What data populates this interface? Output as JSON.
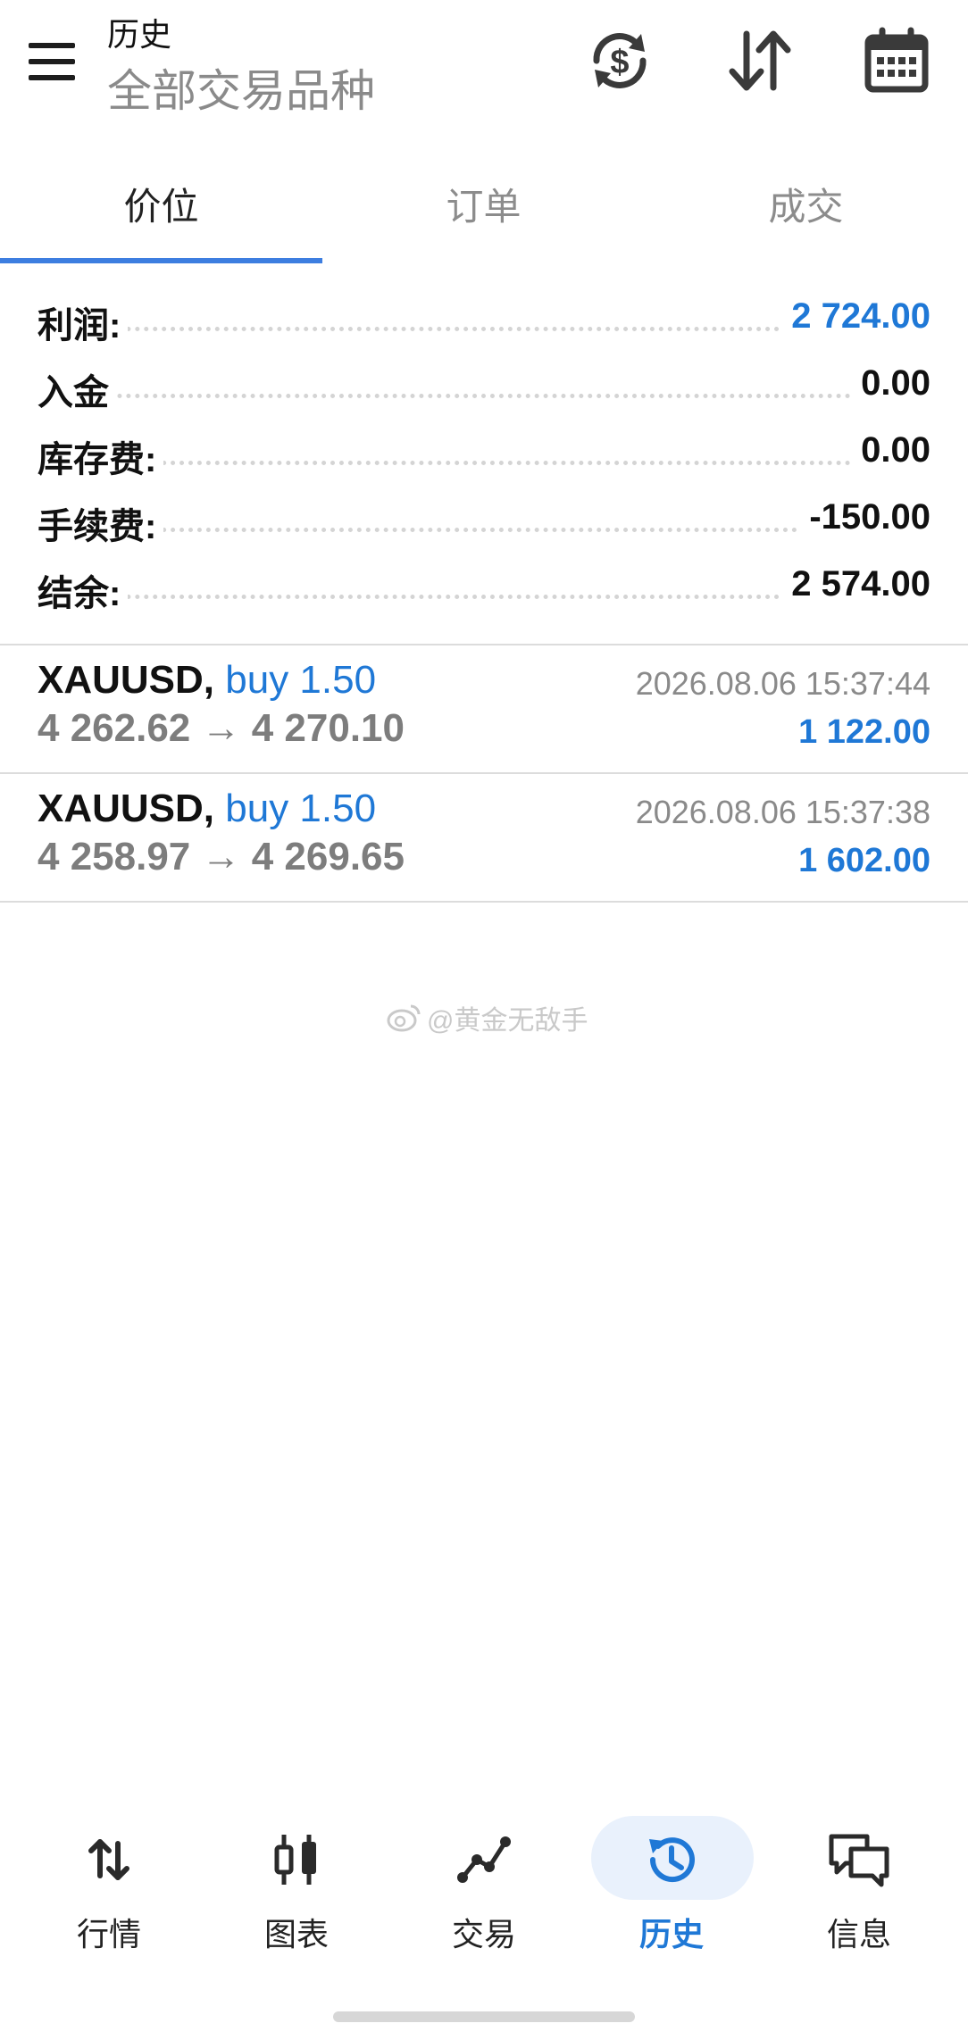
{
  "header": {
    "title": "历史",
    "subtitle": "全部交易品种",
    "icons": [
      "currency-exchange-icon",
      "sort-arrows-icon",
      "calendar-icon"
    ]
  },
  "tabs": [
    {
      "label": "价位",
      "active": true
    },
    {
      "label": "订单",
      "active": false
    },
    {
      "label": "成交",
      "active": false
    }
  ],
  "summary": [
    {
      "label": "利润:",
      "value": "2 724.00",
      "highlight": true
    },
    {
      "label": "入金",
      "value": "0.00",
      "highlight": false
    },
    {
      "label": "库存费:",
      "value": "0.00",
      "highlight": false
    },
    {
      "label": "手续费:",
      "value": "-150.00",
      "highlight": false
    },
    {
      "label": "结余:",
      "value": "2 574.00",
      "highlight": false
    }
  ],
  "deals": [
    {
      "symbol": "XAUUSD,",
      "type": "buy 1.50",
      "prices": "4 262.62 → 4 270.10",
      "time": "2026.08.06 15:37:44",
      "profit": "1 122.00"
    },
    {
      "symbol": "XAUUSD,",
      "type": "buy 1.50",
      "prices": "4 258.97 → 4 269.65",
      "time": "2026.08.06 15:37:38",
      "profit": "1 602.00"
    }
  ],
  "watermark": "@黄金无敌手",
  "bottom_nav": [
    {
      "label": "行情",
      "icon": "quotes-arrows-icon",
      "active": false
    },
    {
      "label": "图表",
      "icon": "candlestick-chart-icon",
      "active": false
    },
    {
      "label": "交易",
      "icon": "trade-line-icon",
      "active": false
    },
    {
      "label": "历史",
      "icon": "history-clock-icon",
      "active": true
    },
    {
      "label": "信息",
      "icon": "messages-icon",
      "active": false
    }
  ],
  "colors": {
    "accent": "#1f78d6",
    "indicator": "#3d7ee0"
  }
}
